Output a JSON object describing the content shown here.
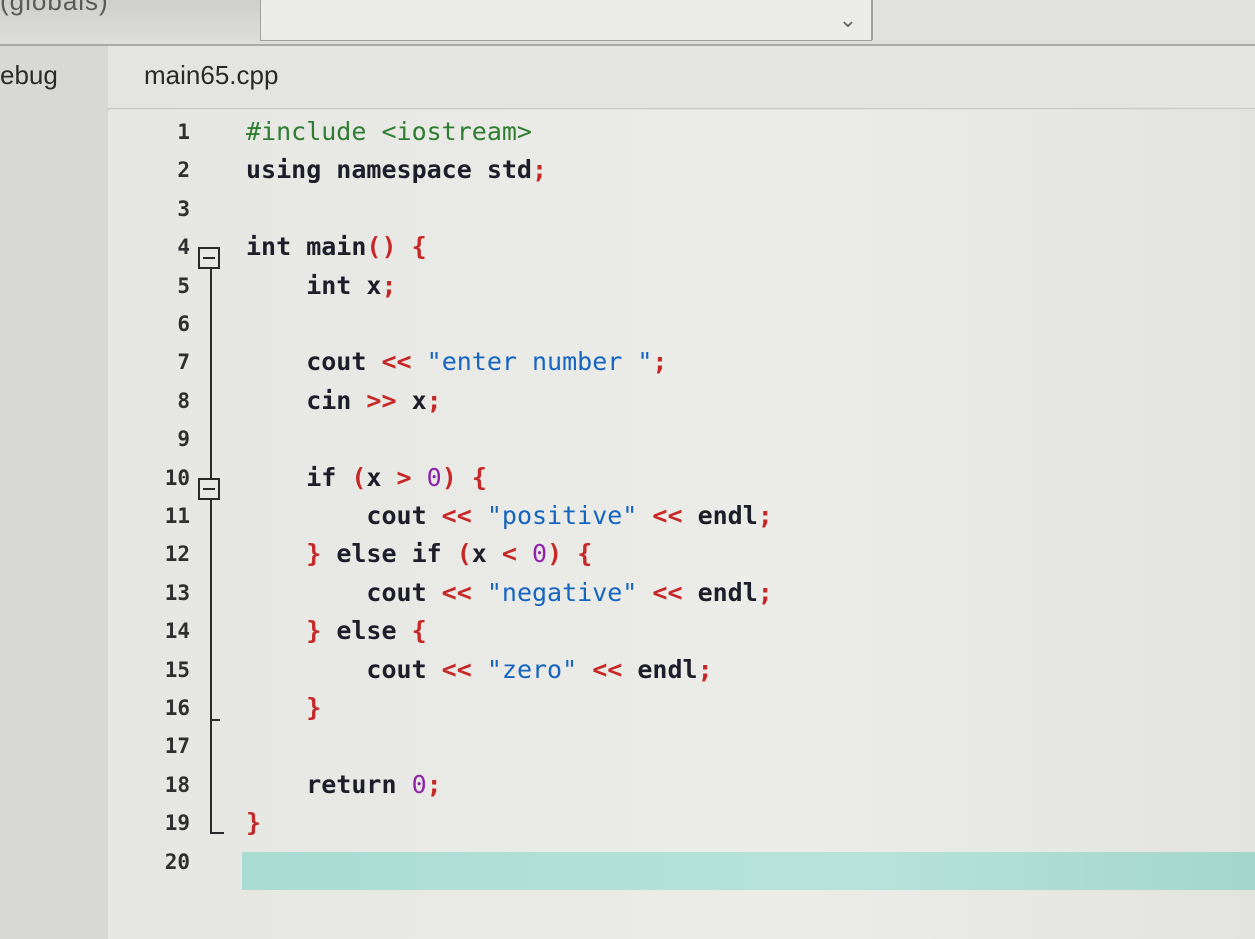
{
  "toolbar": {
    "globals_label": "(globals)",
    "scope_select_icon": "chevron-down-icon"
  },
  "left_panel": {
    "tab_label": "ebug"
  },
  "editor": {
    "file_tab": "main65.cpp",
    "current_line": 20,
    "lines": [
      {
        "n": "1",
        "tokens": [
          {
            "t": "#include <iostream>",
            "c": "pre"
          }
        ]
      },
      {
        "n": "2",
        "tokens": [
          {
            "t": "using namespace std",
            "c": "kw"
          },
          {
            "t": ";",
            "c": "op"
          }
        ]
      },
      {
        "n": "3",
        "tokens": []
      },
      {
        "n": "4",
        "tokens": [
          {
            "t": "int main",
            "c": "kw"
          },
          {
            "t": "() {",
            "c": "op"
          }
        ]
      },
      {
        "n": "5",
        "tokens": [
          {
            "t": "    int x",
            "c": "kw"
          },
          {
            "t": ";",
            "c": "op"
          }
        ]
      },
      {
        "n": "6",
        "tokens": []
      },
      {
        "n": "7",
        "tokens": [
          {
            "t": "    cout ",
            "c": "id"
          },
          {
            "t": "<<",
            "c": "op"
          },
          {
            "t": " ",
            "c": "id"
          },
          {
            "t": "\"enter number \"",
            "c": "str"
          },
          {
            "t": ";",
            "c": "op"
          }
        ]
      },
      {
        "n": "8",
        "tokens": [
          {
            "t": "    cin ",
            "c": "id"
          },
          {
            "t": ">>",
            "c": "op"
          },
          {
            "t": " x",
            "c": "id"
          },
          {
            "t": ";",
            "c": "op"
          }
        ]
      },
      {
        "n": "9",
        "tokens": []
      },
      {
        "n": "10",
        "tokens": [
          {
            "t": "    if ",
            "c": "kw"
          },
          {
            "t": "(",
            "c": "op"
          },
          {
            "t": "x ",
            "c": "id"
          },
          {
            "t": ">",
            "c": "op"
          },
          {
            "t": " ",
            "c": "id"
          },
          {
            "t": "0",
            "c": "num"
          },
          {
            "t": ") {",
            "c": "op"
          }
        ]
      },
      {
        "n": "11",
        "tokens": [
          {
            "t": "        cout ",
            "c": "id"
          },
          {
            "t": "<<",
            "c": "op"
          },
          {
            "t": " ",
            "c": "id"
          },
          {
            "t": "\"positive\"",
            "c": "str"
          },
          {
            "t": " ",
            "c": "id"
          },
          {
            "t": "<<",
            "c": "op"
          },
          {
            "t": " endl",
            "c": "id"
          },
          {
            "t": ";",
            "c": "op"
          }
        ]
      },
      {
        "n": "12",
        "tokens": [
          {
            "t": "    } ",
            "c": "op"
          },
          {
            "t": "else if ",
            "c": "kw"
          },
          {
            "t": "(",
            "c": "op"
          },
          {
            "t": "x ",
            "c": "id"
          },
          {
            "t": "<",
            "c": "op"
          },
          {
            "t": " ",
            "c": "id"
          },
          {
            "t": "0",
            "c": "num"
          },
          {
            "t": ") {",
            "c": "op"
          }
        ]
      },
      {
        "n": "13",
        "tokens": [
          {
            "t": "        cout ",
            "c": "id"
          },
          {
            "t": "<<",
            "c": "op"
          },
          {
            "t": " ",
            "c": "id"
          },
          {
            "t": "\"negative\"",
            "c": "str"
          },
          {
            "t": " ",
            "c": "id"
          },
          {
            "t": "<<",
            "c": "op"
          },
          {
            "t": " endl",
            "c": "id"
          },
          {
            "t": ";",
            "c": "op"
          }
        ]
      },
      {
        "n": "14",
        "tokens": [
          {
            "t": "    } ",
            "c": "op"
          },
          {
            "t": "else ",
            "c": "kw"
          },
          {
            "t": "{",
            "c": "op"
          }
        ]
      },
      {
        "n": "15",
        "tokens": [
          {
            "t": "        cout ",
            "c": "id"
          },
          {
            "t": "<<",
            "c": "op"
          },
          {
            "t": " ",
            "c": "id"
          },
          {
            "t": "\"zero\"",
            "c": "str"
          },
          {
            "t": " ",
            "c": "id"
          },
          {
            "t": "<<",
            "c": "op"
          },
          {
            "t": " endl",
            "c": "id"
          },
          {
            "t": ";",
            "c": "op"
          }
        ]
      },
      {
        "n": "16",
        "tokens": [
          {
            "t": "    }",
            "c": "op"
          }
        ]
      },
      {
        "n": "17",
        "tokens": []
      },
      {
        "n": "18",
        "tokens": [
          {
            "t": "    return ",
            "c": "kw"
          },
          {
            "t": "0",
            "c": "num"
          },
          {
            "t": ";",
            "c": "op"
          }
        ]
      },
      {
        "n": "19",
        "tokens": [
          {
            "t": "}",
            "c": "op"
          }
        ]
      },
      {
        "n": "20",
        "tokens": []
      }
    ]
  },
  "colors": {
    "preprocessor": "#2e7d32",
    "operator": "#c62828",
    "string": "#1565c0",
    "number": "#8e24aa",
    "current_line": "#b8e3da"
  }
}
